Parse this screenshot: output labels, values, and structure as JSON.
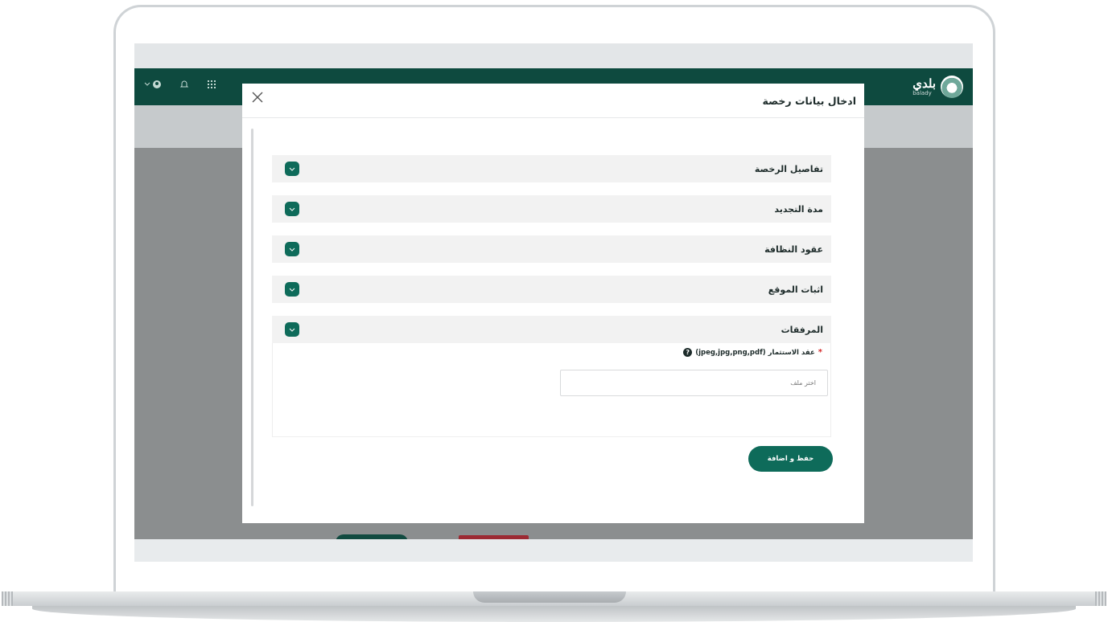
{
  "app": {
    "logo_ar": "بلدي",
    "logo_en": "balady"
  },
  "modal": {
    "title": "ادخال بيانات رخصة",
    "close_icon": "close-icon"
  },
  "accordion": {
    "items": [
      {
        "label": "تفاصيل الرخصة"
      },
      {
        "label": "مدة التجديد"
      },
      {
        "label": "عقود النظافة"
      },
      {
        "label": "اثبات الموقع"
      },
      {
        "label": "المرفقات"
      }
    ]
  },
  "attachments": {
    "field_label": "عقد الاستثمار (jpeg,jpg,png,pdf)",
    "required_mark": "*",
    "help_glyph": "?",
    "file_placeholder": "اختر ملف"
  },
  "actions": {
    "save_label": "حفظ و اضافة"
  },
  "colors": {
    "brand_dark": "#0e4a3f",
    "accent": "#0e6b5a",
    "required": "#d52a2a"
  }
}
